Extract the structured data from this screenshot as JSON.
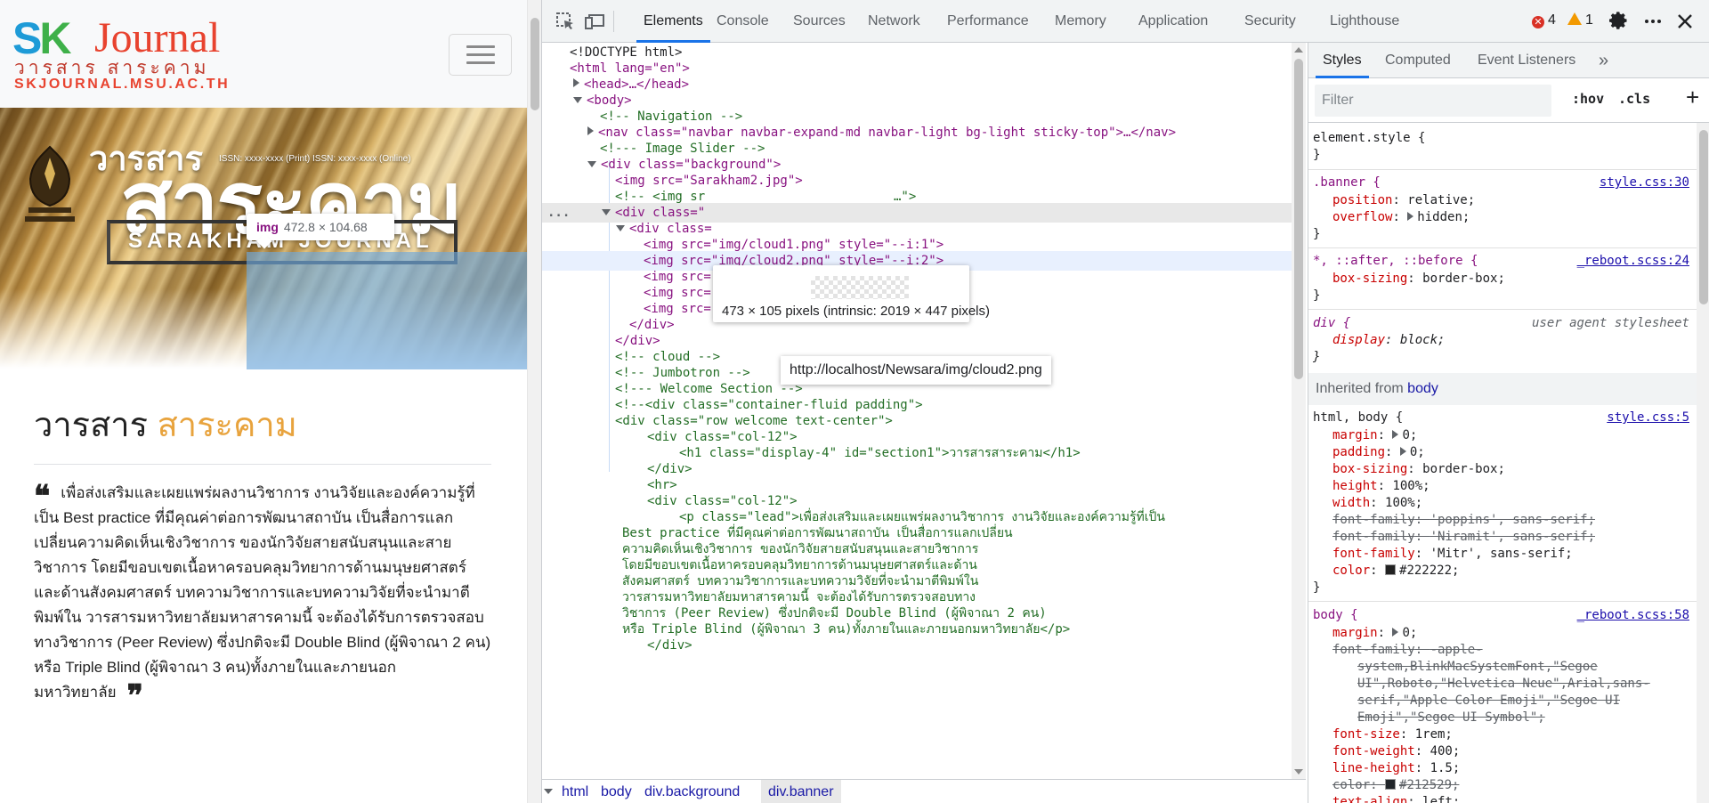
{
  "site": {
    "logo": {
      "sk": "SK",
      "journal": "Journal",
      "thai": "วารสาร สาระคาม",
      "domain": "SKJOURNAL.MSU.AC.TH"
    },
    "banner": {
      "title_small": "วารสาร",
      "issn": "ISSN: xxxx-xxxx (Print)  ISSN: xxxx-xxxx (Online)",
      "title_big": "สาระคาม",
      "subtitle": "SARAKHAM JOURNAL"
    },
    "inspect_chip": {
      "tag": "img",
      "dims": "472.8 × 104.68"
    },
    "welcome": {
      "title_prefix": "วารสาร",
      "title_highlight": "สาระคาม",
      "text": "เพื่อส่งเสริมและเผยแพร่ผลงานวิชาการ งานวิจัยและองค์ความรู้ที่เป็น Best practice ที่มีคุณค่าต่อการพัฒนาสถาบัน เป็นสื่อการแลกเปลี่ยนความคิดเห็นเชิงวิชาการ ของนักวิจัยสายสนับสนุนและสายวิชาการ โดยมีขอบเขตเนื้อหาครอบคลุมวิทยาการด้านมนุษยศาสตร์และด้านสังคมศาสตร์ บทความวิชาการและบทความวิจัยที่จะนำมาตีพิมพ์ใน วารสารมหาวิทยาลัยมหาสารคามนี้ จะต้องได้รับการตรวจสอบทางวิชาการ (Peer Review) ซึ่งปกติจะมี Double Blind (ผู้พิจาณา 2 คน) หรือ Triple Blind (ผู้พิจาณา 3 คน)ทั้งภายในและภายนอกมหาวิทยาลัย"
    }
  },
  "devtools": {
    "tabs": [
      "Elements",
      "Console",
      "Sources",
      "Network",
      "Performance",
      "Memory",
      "Application",
      "Security",
      "Lighthouse"
    ],
    "active_tab": "Elements",
    "errors": "4",
    "warnings": "1",
    "tooltip_size": "473 × 105 pixels (intrinsic: 2019 × 447 pixels)",
    "tooltip_url": "http://localhost/Newsara/img/cloud2.png",
    "ellipsis": "...",
    "dom": [
      "<!DOCTYPE html>",
      "<html lang=\"en\">",
      "<head>…</head>",
      "<body>",
      "<!-- Navigation -->",
      "<nav class=\"navbar navbar-expand-md navbar-light bg-light sticky-top\">…</nav>",
      "<!--- Image Slider -->",
      "<div class=\"background\">",
      "<img src=\"Sarakham2.jpg\">",
      "<!-- <img sr",
      "…\">",
      "<div class=\"",
      "<div class=",
      "<img src=\"img/cloud1.png\" style=\"--i:1\">",
      "<img src=\"img/cloud2.png\" style=\"--i:2\">",
      "<img src=\"img/clo",
      "<img src=\"img/cloud4.png\" style=\"--i:4\">",
      "<img src=\"img/cloud5.png\" style=\"--i:5\">",
      "</div>",
      "</div>",
      "<!-- cloud -->",
      "<!-- Jumbotron -->",
      "<!--- Welcome Section -->",
      "<!--<div class=\"container-fluid padding\">",
      "<div class=\"row welcome text-center\">",
      "<div class=\"col-12\">",
      "<h1 class=\"display-4\" id=\"section1\">วารสารสาระคาม</h1>",
      "</div>",
      "<hr>",
      "<div class=\"col-12\">",
      "<p class=\"lead\">เพื่อส่งเสริมและเผยแพร่ผลงานวิชาการ งานวิจัยและองค์ความรู้ที่เป็น",
      "Best practice ที่มีคุณค่าต่อการพัฒนาสถาบัน เป็นสื่อการแลกเปลี่ยน",
      "ความคิดเห็นเชิงวิชาการ ของนักวิจัยสายสนับสนุนและสายวิชาการ",
      "โดยมีขอบเขตเนื้อหาครอบคลุมวิทยาการด้านมนุษยศาสตร์และด้าน",
      "สังคมศาสตร์ บทความวิชาการและบทความวิจัยที่จะนำมาตีพิมพ์ใน",
      "วารสารมหาวิทยาลัยมหาสารคามนี้ จะต้องได้รับการตรวจสอบทาง",
      "วิชาการ (Peer Review) ซึ่งปกติจะมี Double Blind (ผู้พิจาณา 2 คน)",
      "หรือ Triple Blind (ผู้พิจาณา 3 คน)ทั้งภายในและภายนอกมหาวิทยาลัย</p>",
      "</div>"
    ],
    "breadcrumbs": [
      "html",
      "body",
      "div.background",
      "div.banner"
    ],
    "styles": {
      "tabs": [
        "Styles",
        "Computed",
        "Event Listeners",
        "»"
      ],
      "filter_placeholder": "Filter",
      "hov": ":hov",
      "cls": ".cls",
      "plus": "+",
      "inherited_label": "Inherited from",
      "inherited_from": "body",
      "lines": {
        "element_style": "element.style {",
        "close": "}",
        "banner_sel": ".banner {",
        "banner_src": "style.css:30",
        "position_n": "position",
        "position_v": "relative;",
        "overflow_n": "overflow",
        "overflow_v": "hidden;",
        "star_sel": "*, ::after, ::before {",
        "star_src": "_reboot.scss:24",
        "boxsizing_n": "box-sizing",
        "boxsizing_v": "border-box;",
        "div_sel": "div {",
        "div_src": "user agent stylesheet",
        "display_n": "display",
        "display_v": "block;",
        "htmlbody_sel": "html, body {",
        "htmlbody_src": "style.css:5",
        "margin_n": "margin",
        "margin_v": "0;",
        "padding_n": "padding",
        "padding_v": "0;",
        "bs_n": "box-sizing",
        "bs_v": "border-box;",
        "height_n": "height",
        "height_v": "100%;",
        "width_n": "width",
        "width_v": "100%;",
        "ff1_n": "font-family",
        "ff1_v": "'poppins', sans-serif;",
        "ff2_n": "font-family",
        "ff2_v": "'Niramit', sans-serif;",
        "ff3_n": "font-family",
        "ff3_v": "'Mitr', sans-serif;",
        "color_n": "color",
        "color_v": "#222222;",
        "body_sel": "body {",
        "body_src": "_reboot.scss:58",
        "bmargin_n": "margin",
        "bmargin_v": "0;",
        "bff_n": "font-family",
        "bff_v1": "-apple-",
        "bff_v2": "system,BlinkMacSystemFont,\"Segoe",
        "bff_v3": "UI\",Roboto,\"Helvetica Neue\",Arial,sans-",
        "bff_v4": "serif,\"Apple Color Emoji\",\"Segoe UI",
        "bff_v5": "Emoji\",\"Segoe UI Symbol\";",
        "fs_n": "font-size",
        "fs_v": "1rem;",
        "fw_n": "font-weight",
        "fw_v": "400;",
        "lh_n": "line-height",
        "lh_v": "1.5;",
        "bcolor_n": "color",
        "bcolor_v": "#212529;",
        "ta_n": "text-align",
        "ta_v": "left;"
      }
    }
  }
}
